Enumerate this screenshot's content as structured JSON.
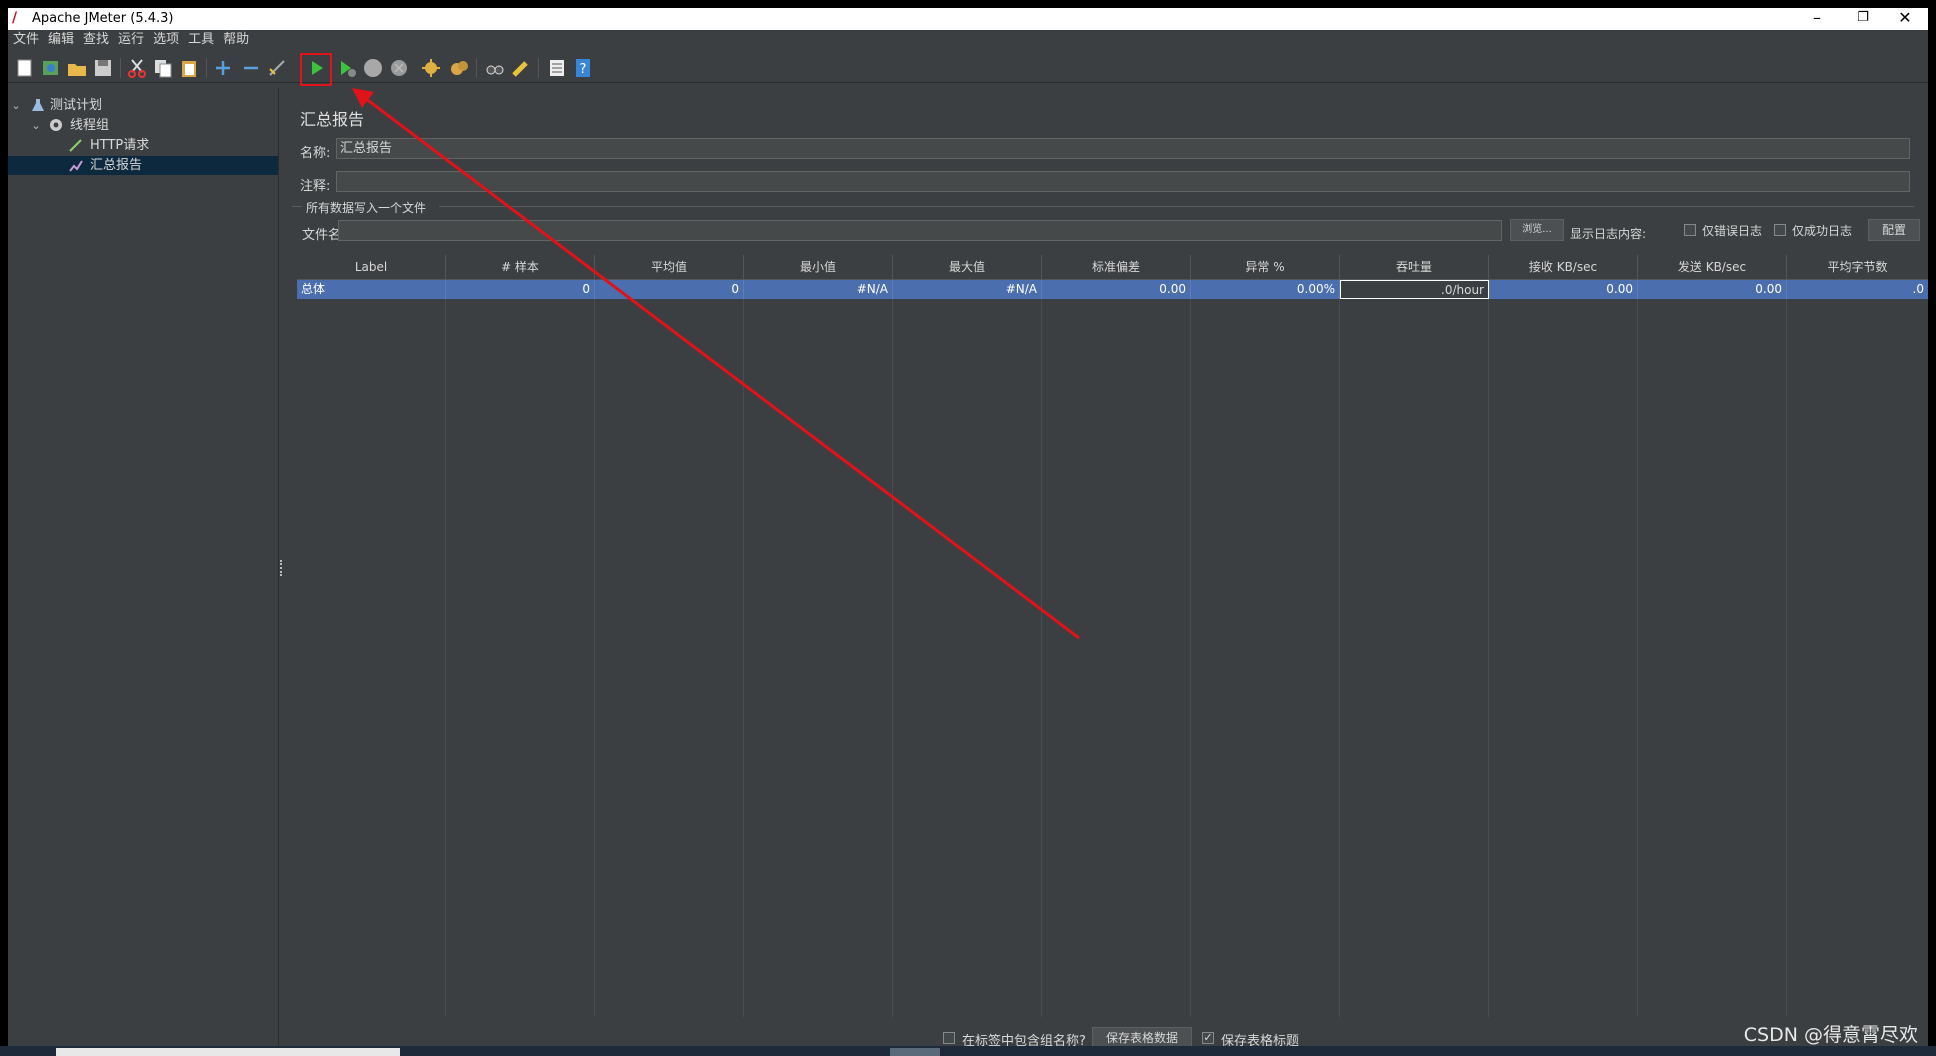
{
  "window": {
    "title": "Apache JMeter (5.4.3)",
    "minimize": "–",
    "maximize": "❐",
    "close": "✕"
  },
  "menu": [
    "文件",
    "编辑",
    "查找",
    "运行",
    "选项",
    "工具",
    "帮助"
  ],
  "tree": {
    "items": [
      {
        "label": "测试计划",
        "icon": "test-plan-icon"
      },
      {
        "label": "线程组",
        "icon": "gear-icon"
      },
      {
        "label": "HTTP请求",
        "icon": "pipette-icon"
      },
      {
        "label": "汇总报告",
        "icon": "chart-icon"
      }
    ]
  },
  "panel": {
    "title": "汇总报告",
    "name_label": "名称:",
    "name_value": "汇总报告",
    "comment_label": "注释:",
    "comment_value": "",
    "group_title": "所有数据写入一个文件",
    "file_label": "文件名",
    "file_value": "",
    "browse_button": "浏览...",
    "log_label": "显示日志内容:",
    "errors_only": "仅错误日志",
    "success_only": "仅成功日志",
    "configure_button": "配置"
  },
  "table": {
    "headers": [
      "Label",
      "# 样本",
      "平均值",
      "最小值",
      "最大值",
      "标准偏差",
      "异常 %",
      "吞吐量",
      "接收 KB/sec",
      "发送 KB/sec",
      "平均字节数"
    ],
    "rows": [
      [
        "总体",
        "0",
        "0",
        "#N/A",
        "#N/A",
        "0.00",
        "0.00%",
        ".0/hour",
        "0.00",
        "0.00",
        ".0"
      ]
    ]
  },
  "bottom": {
    "include_group_label": "在标签中包含组名称?",
    "save_table_button": "保存表格数据",
    "save_header_label": "保存表格标题",
    "save_header_checked": true,
    "include_group_checked": false
  },
  "watermark": "CSDN @得意霄尽欢",
  "colors": {
    "background": "#3c3f41",
    "selection": "#4b6eaf",
    "annotation": "#e0121a"
  }
}
